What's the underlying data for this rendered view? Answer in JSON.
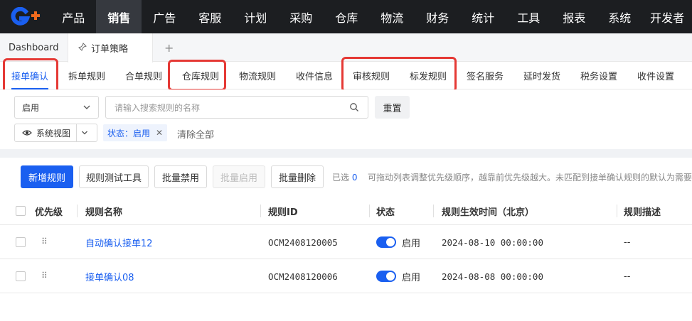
{
  "topnav": {
    "items": [
      "产品",
      "销售",
      "广告",
      "客服",
      "计划",
      "采购",
      "仓库",
      "物流",
      "财务",
      "统计",
      "工具",
      "报表",
      "系统",
      "开发者"
    ],
    "active_index": 1
  },
  "tabs": {
    "dashboard": "Dashboard",
    "current": "订单策略",
    "plus": "+"
  },
  "subtabs": [
    "接单确认",
    "拆单规则",
    "合单规则",
    "仓库规则",
    "物流规则",
    "收件信息",
    "审核规则",
    "标发规则",
    "签名服务",
    "延时发货",
    "税务设置",
    "收件设置"
  ],
  "filter": {
    "status_select": "启用",
    "search_placeholder": "请输入搜索规则的名称",
    "reset_label": "重置",
    "view_label": "系统视图",
    "tag_label": "状态：启用",
    "clear_all": "清除全部"
  },
  "toolbar": {
    "new_rule": "新增规则",
    "test_tool": "规则测试工具",
    "batch_disable": "批量禁用",
    "batch_enable": "批量启用",
    "batch_delete": "批量删除",
    "selected_prefix": "已选",
    "selected_count": "0",
    "hint": "可拖动列表调整优先级顺序，越靠前优先级越大。未匹配到接单确认规则的默认为需要"
  },
  "table": {
    "headers": [
      "优先级",
      "规则名称",
      "规则ID",
      "状态",
      "规则生效时间（北京）",
      "规则描述"
    ],
    "rows": [
      {
        "name": "自动确认接单12",
        "id": "OCM2408120005",
        "status": "启用",
        "time": "2024-08-10 00:00:00",
        "desc": "--"
      },
      {
        "name": "接单确认08",
        "id": "OCM2408120006",
        "status": "启用",
        "time": "2024-08-08 00:00:00",
        "desc": "--"
      }
    ]
  },
  "colors": {
    "primary": "#1a5ff0",
    "nav_bg": "#1c1e21",
    "highlight": "#e53935",
    "logo_orange": "#f26b1d"
  }
}
